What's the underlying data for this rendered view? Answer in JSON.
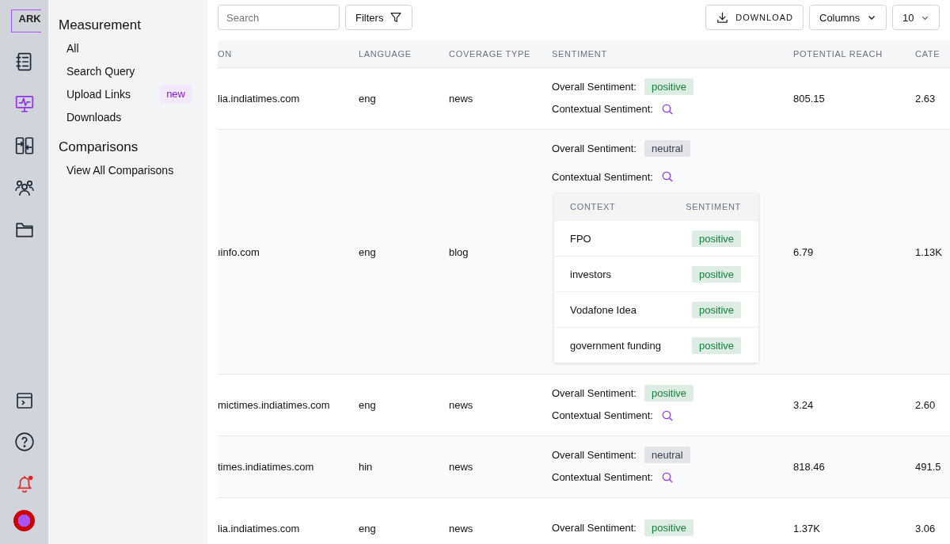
{
  "logo": {
    "text": "ARK"
  },
  "rail": {
    "top": [
      {
        "selected": false
      },
      {
        "selected": true
      },
      {
        "selected": false
      },
      {
        "selected": false
      },
      {
        "selected": false
      }
    ],
    "notification": {
      "unread": true
    }
  },
  "nav": {
    "sections": [
      {
        "title": "Measurement",
        "items": [
          {
            "label": "All"
          },
          {
            "label": "Search Query"
          },
          {
            "label": "Upload Links",
            "badge": "new"
          },
          {
            "label": "Downloads"
          }
        ]
      },
      {
        "title": "Comparisons",
        "items": [
          {
            "label": "View All Comparisons"
          }
        ]
      }
    ]
  },
  "toolbar": {
    "search": {
      "placeholder": "Search"
    },
    "filters": "Filters",
    "download": "DOWNLOAD",
    "columns": "Columns",
    "page_size": "10"
  },
  "table": {
    "columns": [
      "ON",
      "LANGUAGE",
      "COVERAGE TYPE",
      "SENTIMENT",
      "POTENTIAL REACH",
      "CATE"
    ],
    "rows": [
      {
        "source": "lia.indiatimes.com",
        "language": "eng",
        "coverage": "news",
        "overall_label": "Overall Sentiment:",
        "overall": "positive",
        "color": "#15803d",
        "contextual_label": "Contextual Sentiment:",
        "reach": "805.15",
        "column_6": "2.63"
      },
      {
        "source": "ıinfo.com",
        "language": "eng",
        "coverage": "blog",
        "overall_label": "Overall Sentiment:",
        "overall": "neutral",
        "color": "#374151",
        "contextual_label": "Contextual Sentiment:",
        "context_table": {
          "columns": [
            "CONTEXT",
            "SENTIMENT"
          ],
          "rows": [
            {
              "context": "FPO",
              "sentiment": "positive",
              "color": "#15803d"
            },
            {
              "context": "investors",
              "sentiment": "positive",
              "color": "#15803d"
            },
            {
              "context": "Vodafone Idea",
              "sentiment": "positive",
              "color": "#15803d"
            },
            {
              "context": "government funding",
              "sentiment": "positive",
              "color": "#15803d"
            }
          ]
        },
        "reach": "6.79",
        "column_6": "1.13K"
      },
      {
        "source": "mictimes.indiatimes.com",
        "language": "eng",
        "coverage": "news",
        "overall_label": "Overall Sentiment:",
        "overall": "positive",
        "color": "#15803d",
        "contextual_label": "Contextual Sentiment:",
        "reach": "3.24",
        "column_6": "2.60"
      },
      {
        "source": "times.indiatimes.com",
        "language": "hin",
        "coverage": "news",
        "overall_label": "Overall Sentiment:",
        "overall": "neutral",
        "color": "#374151",
        "contextual_label": "Contextual Sentiment:",
        "reach": "818.46",
        "column_6": "491.5"
      },
      {
        "source": "lia.indiatimes.com",
        "language": "eng",
        "coverage": "news",
        "overall_label": "Overall Sentiment:",
        "overall": "positive",
        "color": "#15803d",
        "reach": "1.37K",
        "column_6": "3.06"
      }
    ]
  }
}
